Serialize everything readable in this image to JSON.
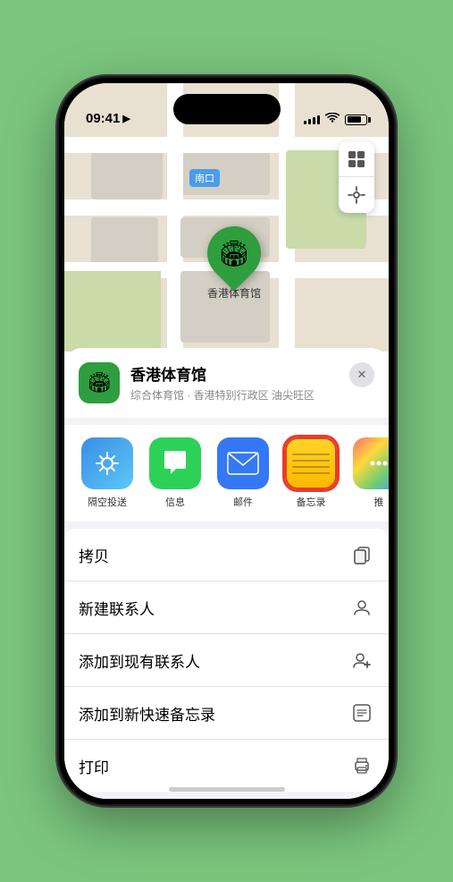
{
  "statusBar": {
    "time": "09:41",
    "locationIcon": "▶"
  },
  "map": {
    "locationLabel": "南口",
    "venuePin": "🏟",
    "venuePinLabel": "香港体育馆",
    "mapLayerIcon": "🗺",
    "locationIcon": "◉"
  },
  "bottomSheet": {
    "venueIcon": "🏟",
    "venueName": "香港体育馆",
    "venueSubtitle": "综合体育馆 · 香港特别行政区 油尖旺区",
    "closeLabel": "✕"
  },
  "shareApps": [
    {
      "id": "airdrop",
      "label": "隔空投送",
      "type": "airdrop"
    },
    {
      "id": "messages",
      "label": "信息",
      "type": "messages"
    },
    {
      "id": "mail",
      "label": "邮件",
      "type": "mail"
    },
    {
      "id": "notes",
      "label": "备忘录",
      "type": "notes",
      "selected": true
    },
    {
      "id": "more",
      "label": "推",
      "type": "more"
    }
  ],
  "actions": [
    {
      "label": "拷贝",
      "icon": "📋"
    },
    {
      "label": "新建联系人",
      "icon": "👤"
    },
    {
      "label": "添加到现有联系人",
      "icon": "👤+"
    },
    {
      "label": "添加到新快速备忘录",
      "icon": "📝"
    },
    {
      "label": "打印",
      "icon": "🖨"
    }
  ]
}
